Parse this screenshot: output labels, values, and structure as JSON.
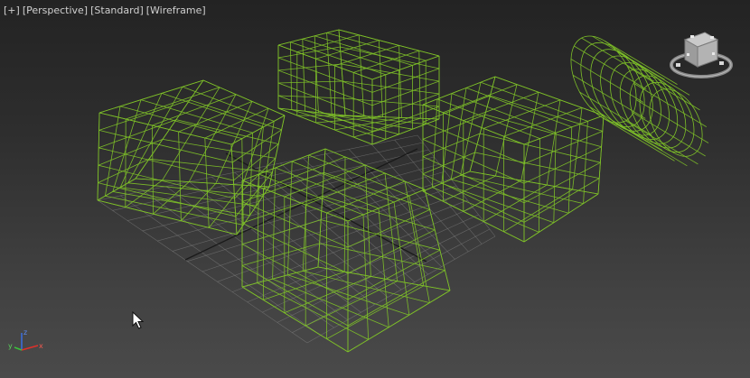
{
  "viewport": {
    "labels": {
      "menu": "[+]",
      "view": "[Perspective]",
      "shading": "[Standard]",
      "display": "[Wireframe]"
    },
    "colors": {
      "wire": "#7ec128",
      "grid": "#8a8a8a",
      "axis_line": "#1a1a1a",
      "x_axis": "#e0302a",
      "y_axis": "#3ac23a",
      "z_axis": "#3a6fe0"
    },
    "axis_gizmo": {
      "x": "x",
      "y": "y",
      "z": "z"
    },
    "icons": [
      "viewcube-icon",
      "axis-tripod-icon",
      "mouse-pointer-icon"
    ]
  }
}
